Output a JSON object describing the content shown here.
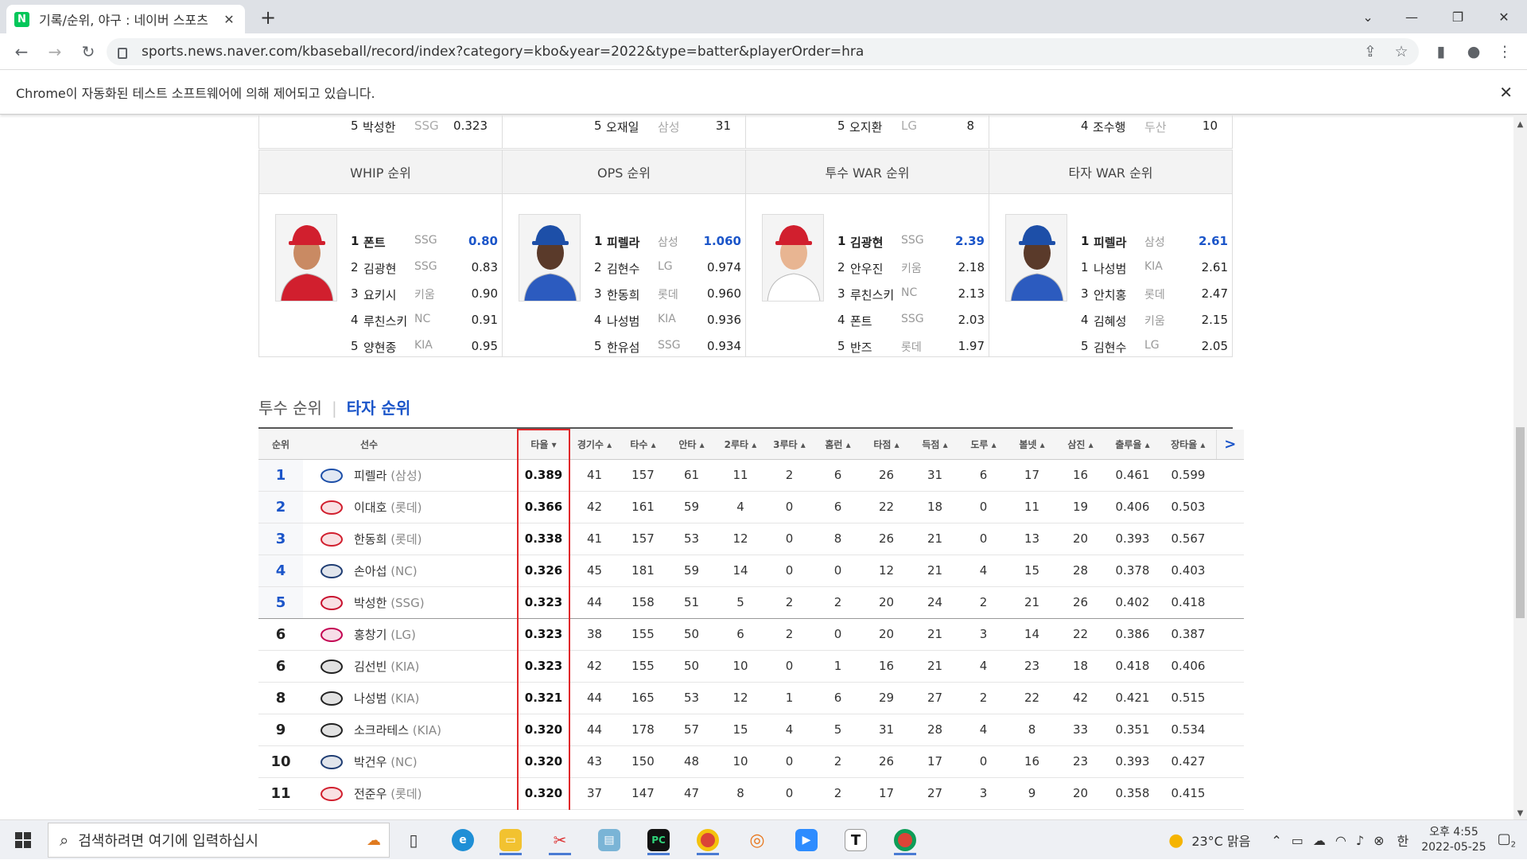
{
  "browser": {
    "tab_title": "기록/순위, 야구 : 네이버 스포츠",
    "url": "sports.news.naver.com/kbaseball/record/index?category=kbo&year=2022&type=batter&playerOrder=hra",
    "infobar": "Chrome이 자동화된 테스트 소프트웨어에 의해 제어되고 있습니다."
  },
  "top_rows": [
    {
      "rank": "5",
      "name": "박성한",
      "team": "SSG",
      "value": "0.323"
    },
    {
      "rank": "5",
      "name": "오재일",
      "team": "삼성",
      "value": "31"
    },
    {
      "rank": "5",
      "name": "오지환",
      "team": "LG",
      "value": "8"
    },
    {
      "rank": "4",
      "name": "조수행",
      "team": "두산",
      "value": "10"
    }
  ],
  "leader_boxes": [
    {
      "title": "WHIP 순위",
      "cap": "#d11f2e",
      "skin": "#c98a63",
      "jersey": "#d11f2e",
      "rows": [
        {
          "rank": "1",
          "name": "폰트",
          "team": "SSG",
          "value": "0.80"
        },
        {
          "rank": "2",
          "name": "김광현",
          "team": "SSG",
          "value": "0.83"
        },
        {
          "rank": "3",
          "name": "요키시",
          "team": "키움",
          "value": "0.90"
        },
        {
          "rank": "4",
          "name": "루친스키",
          "team": "NC",
          "value": "0.91"
        },
        {
          "rank": "5",
          "name": "양현종",
          "team": "KIA",
          "value": "0.95"
        }
      ]
    },
    {
      "title": "OPS 순위",
      "cap": "#1d4fa8",
      "skin": "#5a3a2a",
      "jersey": "#2c5bbf",
      "rows": [
        {
          "rank": "1",
          "name": "피렐라",
          "team": "삼성",
          "value": "1.060"
        },
        {
          "rank": "2",
          "name": "김현수",
          "team": "LG",
          "value": "0.974"
        },
        {
          "rank": "3",
          "name": "한동희",
          "team": "롯데",
          "value": "0.960"
        },
        {
          "rank": "4",
          "name": "나성범",
          "team": "KIA",
          "value": "0.936"
        },
        {
          "rank": "5",
          "name": "한유섬",
          "team": "SSG",
          "value": "0.934"
        }
      ]
    },
    {
      "title": "투수 WAR 순위",
      "cap": "#d11f2e",
      "skin": "#e8b592",
      "jersey": "#ffffff",
      "rows": [
        {
          "rank": "1",
          "name": "김광현",
          "team": "SSG",
          "value": "2.39"
        },
        {
          "rank": "2",
          "name": "안우진",
          "team": "키움",
          "value": "2.18"
        },
        {
          "rank": "3",
          "name": "루친스키",
          "team": "NC",
          "value": "2.13"
        },
        {
          "rank": "4",
          "name": "폰트",
          "team": "SSG",
          "value": "2.03"
        },
        {
          "rank": "5",
          "name": "반즈",
          "team": "롯데",
          "value": "1.97"
        }
      ]
    },
    {
      "title": "타자 WAR 순위",
      "cap": "#1d4fa8",
      "skin": "#5a3a2a",
      "jersey": "#2c5bbf",
      "rows": [
        {
          "rank": "1",
          "name": "피렐라",
          "team": "삼성",
          "value": "2.61"
        },
        {
          "rank": "1",
          "name": "나성범",
          "team": "KIA",
          "value": "2.61"
        },
        {
          "rank": "3",
          "name": "안치홍",
          "team": "롯데",
          "value": "2.47"
        },
        {
          "rank": "4",
          "name": "김혜성",
          "team": "키움",
          "value": "2.15"
        },
        {
          "rank": "5",
          "name": "김현수",
          "team": "LG",
          "value": "2.05"
        }
      ]
    }
  ],
  "section_tabs": {
    "pitcher": "투수 순위",
    "batter": "타자 순위"
  },
  "columns": [
    "순위",
    "선수",
    "타율 ▾",
    "경기수 ▴",
    "타수 ▴",
    "안타 ▴",
    "2루타 ▴",
    "3루타 ▴",
    "홈런 ▴",
    "타점 ▴",
    "득점 ▴",
    "도루 ▴",
    "볼넷 ▴",
    "삼진 ▴",
    "출루율 ▴",
    "장타율 ▴"
  ],
  "next_label": ">",
  "rows": [
    {
      "rank": "1",
      "name": "피렐라",
      "team": "(삼성)",
      "logo": "#1d4fa8",
      "avg": "0.389",
      "stats": [
        "41",
        "157",
        "61",
        "11",
        "2",
        "6",
        "26",
        "31",
        "6",
        "17",
        "16",
        "0.461",
        "0.599"
      ]
    },
    {
      "rank": "2",
      "name": "이대호",
      "team": "(롯데)",
      "logo": "#d11f2e",
      "avg": "0.366",
      "stats": [
        "42",
        "161",
        "59",
        "4",
        "0",
        "6",
        "22",
        "18",
        "0",
        "11",
        "19",
        "0.406",
        "0.503"
      ]
    },
    {
      "rank": "3",
      "name": "한동희",
      "team": "(롯데)",
      "logo": "#d11f2e",
      "avg": "0.338",
      "stats": [
        "41",
        "157",
        "53",
        "12",
        "0",
        "8",
        "26",
        "21",
        "0",
        "13",
        "20",
        "0.393",
        "0.567"
      ]
    },
    {
      "rank": "4",
      "name": "손아섭",
      "team": "(NC)",
      "logo": "#1f3d73",
      "avg": "0.326",
      "stats": [
        "45",
        "181",
        "59",
        "14",
        "0",
        "0",
        "12",
        "21",
        "4",
        "15",
        "28",
        "0.378",
        "0.403"
      ]
    },
    {
      "rank": "5",
      "name": "박성한",
      "team": "(SSG)",
      "logo": "#c8102e",
      "avg": "0.323",
      "stats": [
        "44",
        "158",
        "51",
        "5",
        "2",
        "2",
        "20",
        "24",
        "2",
        "21",
        "26",
        "0.402",
        "0.418"
      ]
    },
    {
      "rank": "6",
      "name": "홍창기",
      "team": "(LG)",
      "logo": "#c30452",
      "avg": "0.323",
      "stats": [
        "38",
        "155",
        "50",
        "6",
        "2",
        "0",
        "20",
        "21",
        "3",
        "14",
        "22",
        "0.386",
        "0.387"
      ]
    },
    {
      "rank": "6",
      "name": "김선빈",
      "team": "(KIA)",
      "logo": "#222222",
      "avg": "0.323",
      "stats": [
        "42",
        "155",
        "50",
        "10",
        "0",
        "1",
        "16",
        "21",
        "4",
        "23",
        "18",
        "0.418",
        "0.406"
      ]
    },
    {
      "rank": "8",
      "name": "나성범",
      "team": "(KIA)",
      "logo": "#222222",
      "avg": "0.321",
      "stats": [
        "44",
        "165",
        "53",
        "12",
        "1",
        "6",
        "29",
        "27",
        "2",
        "22",
        "42",
        "0.421",
        "0.515"
      ]
    },
    {
      "rank": "9",
      "name": "소크라테스",
      "team": "(KIA)",
      "logo": "#222222",
      "avg": "0.320",
      "stats": [
        "44",
        "178",
        "57",
        "15",
        "4",
        "5",
        "31",
        "28",
        "4",
        "8",
        "33",
        "0.351",
        "0.534"
      ]
    },
    {
      "rank": "10",
      "name": "박건우",
      "team": "(NC)",
      "logo": "#1f3d73",
      "avg": "0.320",
      "stats": [
        "43",
        "150",
        "48",
        "10",
        "0",
        "2",
        "26",
        "17",
        "0",
        "16",
        "23",
        "0.393",
        "0.427"
      ]
    },
    {
      "rank": "11",
      "name": "전준우",
      "team": "(롯데)",
      "logo": "#d11f2e",
      "avg": "0.320",
      "stats": [
        "37",
        "147",
        "47",
        "8",
        "0",
        "2",
        "17",
        "27",
        "3",
        "9",
        "20",
        "0.358",
        "0.415"
      ]
    }
  ],
  "taskbar": {
    "search_placeholder": "검색하려면 여기에 입력하십시",
    "weather": "23°C 맑음",
    "ime": "한",
    "time": "오후 4:55",
    "date": "2022-05-25",
    "notif": "2"
  }
}
